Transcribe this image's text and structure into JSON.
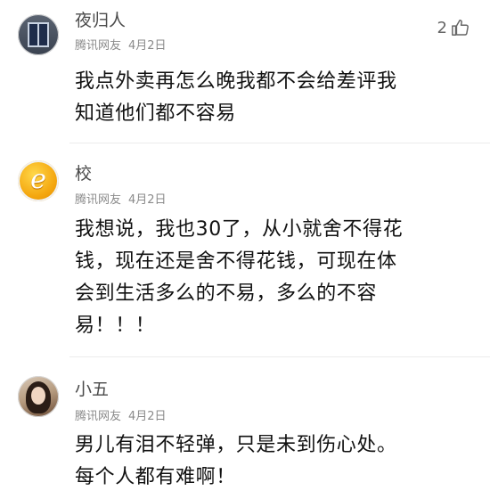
{
  "comments": [
    {
      "username": "夜归人",
      "source": "腾讯网友",
      "date": "4月2日",
      "text_lines": [
        "我点外卖再怎么晚我都不会给差评我",
        "知道他们都不容易"
      ],
      "likes": "2"
    },
    {
      "username": "校",
      "source": "腾讯网友",
      "date": "4月2日",
      "text_lines": [
        "我想说，我也30了，从小就舍不得花",
        "钱，现在还是舍不得花钱，可现在体",
        "会到生活多么的不易，多么的不容",
        "易！！！"
      ]
    },
    {
      "username": "小五",
      "source": "腾讯网友",
      "date": "4月2日",
      "text_lines": [
        "男儿有泪不轻弹，只是未到伤心处。",
        "每个人都有难啊！"
      ]
    }
  ],
  "icons": {
    "like": "thumbs-up-icon"
  }
}
